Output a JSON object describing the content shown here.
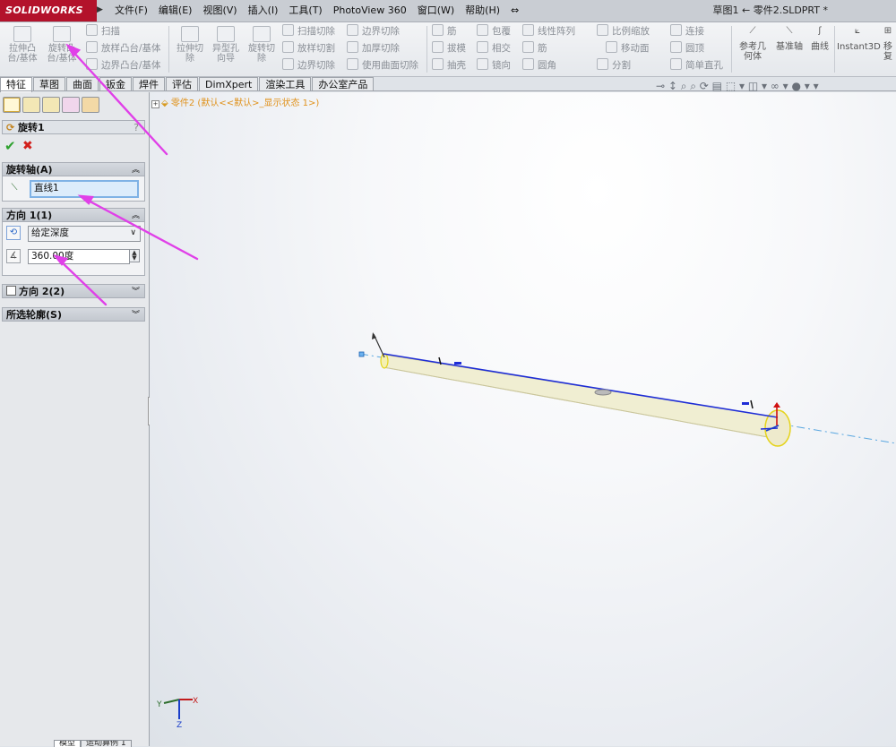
{
  "app": {
    "logo_text": "SOLIDWORKS",
    "document_title": "草图1 ← 零件2.SLDPRT *"
  },
  "menu": [
    "文件(F)",
    "编辑(E)",
    "视图(V)",
    "插入(I)",
    "工具(T)",
    "PhotoView 360",
    "窗口(W)",
    "帮助(H)"
  ],
  "command_manager": {
    "extrude_boss": "拉伸凸\n台/基体",
    "revolve_boss": "旋转凸\n台/基体",
    "sweep": "扫描",
    "loft_boss": "放样凸台/基体",
    "boundary_boss": "边界凸台/基体",
    "extrude_cut": "拉伸切\n除",
    "hole_wizard": "异型孔\n向导",
    "revolve_cut": "旋转切\n除",
    "sweep_cut": "扫描切除",
    "loft_cut": "放样切割",
    "boundary_cut": "边界切除",
    "boundary_cut2": "边界切除",
    "thicken_cut": "加厚切除",
    "surface_cut": "使用曲面切除",
    "rib": "筋",
    "draft": "拔模",
    "shell": "抽壳",
    "wrap": "包覆",
    "intersect": "相交",
    "mirror": "镜向",
    "linear_pattern": "线性阵列",
    "rib2": "筋",
    "fillet": "圆角",
    "scale": "比例缩放",
    "move_face": "移动面",
    "split": "分割",
    "connect": "连接",
    "dome": "圆顶",
    "simple_hole": "简单直孔",
    "ref_geometry": "参考几\n何体",
    "datum_axis": "基准轴",
    "curves": "曲线",
    "instant3d": "Instant3D",
    "more": "移\n复"
  },
  "tabs": [
    "特征",
    "草图",
    "曲面",
    "钣金",
    "焊件",
    "评估",
    "DimXpert",
    "渲染工具",
    "办公室产品"
  ],
  "property_manager": {
    "feature_title": "旋转1",
    "help": "?",
    "axis_section": {
      "title": "旋转轴(A)",
      "value": "直线1"
    },
    "direction1": {
      "title": "方向 1(1)",
      "end_condition": "给定深度",
      "angle": "360.00度"
    },
    "direction2": {
      "title": "方向 2(2)",
      "checked": false
    },
    "contours": {
      "title": "所选轮廓(S)"
    }
  },
  "tree": {
    "root": "零件2  (默认<<默认>_显示状态 1>)"
  },
  "triad": {
    "x": "X",
    "y": "Y",
    "z": "Z"
  },
  "bottom_tabs": [
    "",
    "模型",
    "运动算例 1"
  ],
  "colors": {
    "logo_bg": "#b3122b",
    "annotation_arrow": "#e040e8",
    "sketch_line": "#1e2dd6",
    "cylinder_fill": "#f0eed2"
  }
}
